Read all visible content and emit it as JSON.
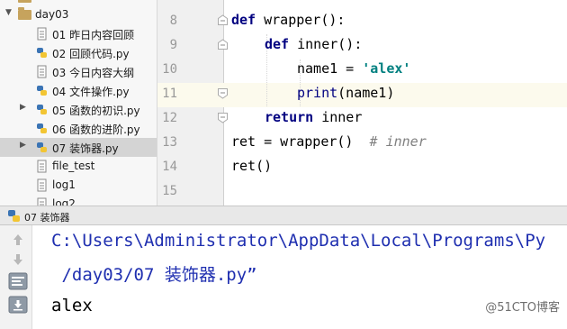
{
  "project_tree": {
    "folder": "day03",
    "items": [
      {
        "name": "01 昨日内容回顾",
        "type": "txt"
      },
      {
        "name": "02 回顾代码.py",
        "type": "py"
      },
      {
        "name": "03 今日内容大纲",
        "type": "txt"
      },
      {
        "name": "04 文件操作.py",
        "type": "py"
      },
      {
        "name": "05 函数的初识.py",
        "type": "py",
        "collapsible": true
      },
      {
        "name": "06 函数的进阶.py",
        "type": "py"
      },
      {
        "name": "07 装饰器.py",
        "type": "py",
        "collapsible": true,
        "selected": true
      },
      {
        "name": "file_test",
        "type": "txt"
      },
      {
        "name": "log1",
        "type": "txt"
      },
      {
        "name": "log2",
        "type": "txt"
      }
    ]
  },
  "editor": {
    "line_numbers": [
      "8",
      "9",
      "10",
      "11",
      "12",
      "13",
      "14",
      "15"
    ],
    "current_line": "11",
    "code": {
      "l8_kw": "def",
      "l8_rest": " wrapper():",
      "l9_kw": "def",
      "l9_rest": " inner():",
      "l10_a": "name1 = ",
      "l10_str": "'alex'",
      "l11_fn": "print",
      "l11_rest": "(name1)",
      "l12_kw": "return",
      "l12_rest": " inner",
      "l13_code": "ret = wrapper()  ",
      "l13_comment": "# inner",
      "l14_code": "ret()"
    }
  },
  "run_panel": {
    "tab_label": "07 装饰器",
    "output_lines": [
      "C:\\Users\\Administrator\\AppData\\Local\\Programs\\Py",
      " /day03/07 装饰器.py”",
      "alex"
    ]
  },
  "watermark": "@51CTO博客",
  "colors": {
    "keyword": "#000080",
    "string": "#008080",
    "comment": "#808080",
    "path_output": "#1f2fb0",
    "normal_output": "#000000",
    "current_line_bg": "#fcfaed",
    "selected_row_bg": "#d4d4d4"
  }
}
